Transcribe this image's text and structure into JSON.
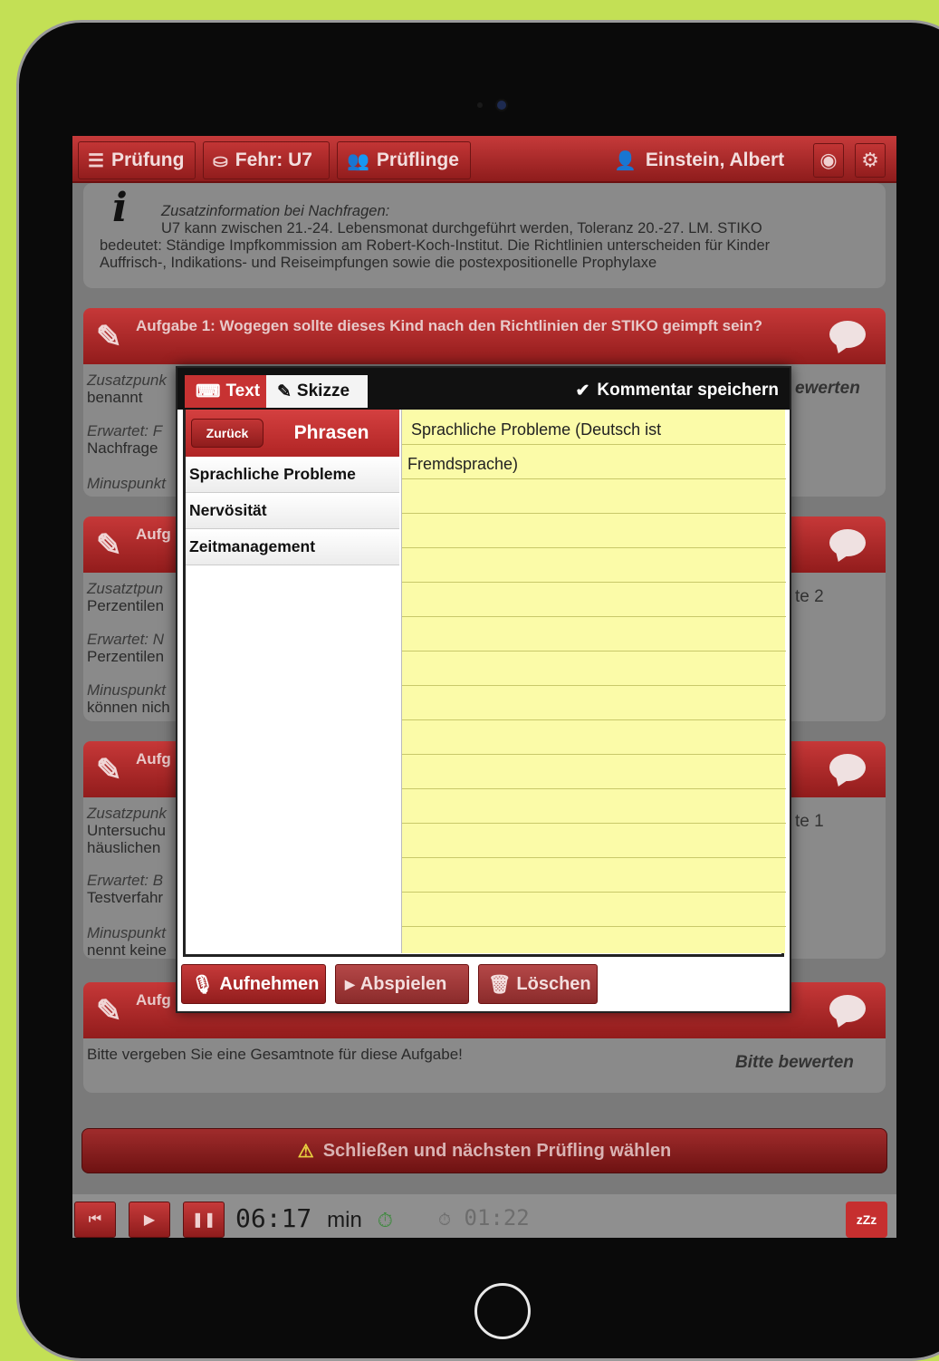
{
  "nav": {
    "pruefung": "Prüfung",
    "fehr": "Fehr: U7",
    "pruefling": "Prüflinge",
    "user": "Einstein, Albert"
  },
  "info": {
    "heading": "Zusatzinformation bei Nachfragen:",
    "line1": "U7 kann zwischen 21.-24. Lebensmonat durchgeführt werden, Toleranz 20.-27. LM. STIKO",
    "line2": "bedeutet: Ständige Impfkommission am Robert-Koch-Institut. Die Richtlinien unterscheiden für Kinder",
    "line3": "Auffrisch-, Indikations- und Reiseimpfungen sowie die postexpositionelle Prophylaxe"
  },
  "tasks": {
    "t1_title": "Aufgabe 1: Wogegen sollte dieses Kind nach den Richtlinien der STIKO geimpft sein?",
    "t1_zusatz": "Zusatzpunk",
    "t1_zusatz2": "benannt",
    "t1_erwartet": "Erwartet: F",
    "t1_erwartet2": "Nachfrage",
    "t1_minus": "Minuspunkt",
    "t1_right": "ewerten",
    "t2_title": "Aufg",
    "t2_zusatz": "Zusatztpun",
    "t2_zusatz2": "Perzentilen",
    "t2_erwartet": "Erwartet: N",
    "t2_erwartet2": "Perzentilen",
    "t2_minus": "Minuspunkt",
    "t2_minus2": "können nich",
    "t2_right": "te 2",
    "t3_title": "Aufg",
    "t3_zusatz": "Zusatzpunk",
    "t3_zusatz2": "Untersuchu",
    "t3_zusatz3": "häuslichen",
    "t3_erwartet": "Erwartet: B",
    "t3_erwartet2": "Testverfahr",
    "t3_minus": "Minuspunkt",
    "t3_minus2": "nennt keine",
    "t3_right": "te 1",
    "t4_title": "Aufg",
    "t4_text": "Bitte vergeben Sie eine Gesamtnote für diese Aufgabe!",
    "t4_right": "Bitte bewerten"
  },
  "footer": {
    "close": "Schließen und nächsten Prüfling wählen"
  },
  "timer": {
    "value": "06:17",
    "unit": "min",
    "secondary": "01:22"
  },
  "modal": {
    "tab_text": "Text",
    "tab_skizze": "Skizze",
    "save": "Kommentar speichern",
    "back": "Zurück",
    "phrasen": "Phrasen",
    "phrases": [
      "Sprachliche Probleme",
      "Nervösität",
      "Zeitmanagement"
    ],
    "note_line1": "Sprachliche Probleme (Deutsch ist",
    "note_line2": "Fremdsprache)",
    "record": "Aufnehmen",
    "play": "Abspielen",
    "delete": "Löschen"
  }
}
